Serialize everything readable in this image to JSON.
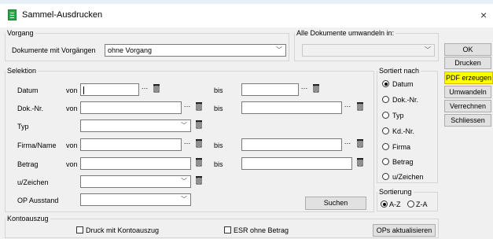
{
  "window": {
    "title": "Sammel-Ausdrucken",
    "close_icon": "×"
  },
  "vorgang": {
    "legend": "Vorgang",
    "label": "Dokumente mit Vorgängen",
    "value": "ohne Vorgang"
  },
  "umwandeln": {
    "legend": "Alle Dokumente umwandeln in:",
    "value": ""
  },
  "buttons": {
    "ok": "OK",
    "drucken": "Drucken",
    "pdf": "PDF erzeugen",
    "umwandeln": "Umwandeln",
    "verrechnen": "Verrechnen",
    "schliessen": "Schliessen",
    "suchen": "Suchen",
    "ops": "OPs aktualisieren"
  },
  "selektion": {
    "legend": "Selektion",
    "von": "von",
    "bis": "bis",
    "rows": {
      "datum": "Datum",
      "doknr": "Dok.-Nr.",
      "typ": "Typ",
      "firma": "Firma/Name",
      "betrag": "Betrag",
      "uzeichen": "u/Zeichen",
      "op": "OP Ausstand"
    }
  },
  "sortiert": {
    "legend": "Sortiert nach",
    "options": [
      "Datum",
      "Dok.-Nr.",
      "Typ",
      "Kd.-Nr.",
      "Firma",
      "Betrag",
      "u/Zeichen"
    ],
    "selected": "Datum"
  },
  "sortierung": {
    "legend": "Sortierung",
    "az": "A-Z",
    "za": "Z-A",
    "selected": "A-Z"
  },
  "kontoauszug": {
    "legend": "Kontoauszug",
    "druck": "Druck mit Kontoauszug",
    "esr": "ESR ohne Betrag"
  },
  "colors": {
    "highlight": "#ffff00",
    "accent": "#2aa84a"
  }
}
